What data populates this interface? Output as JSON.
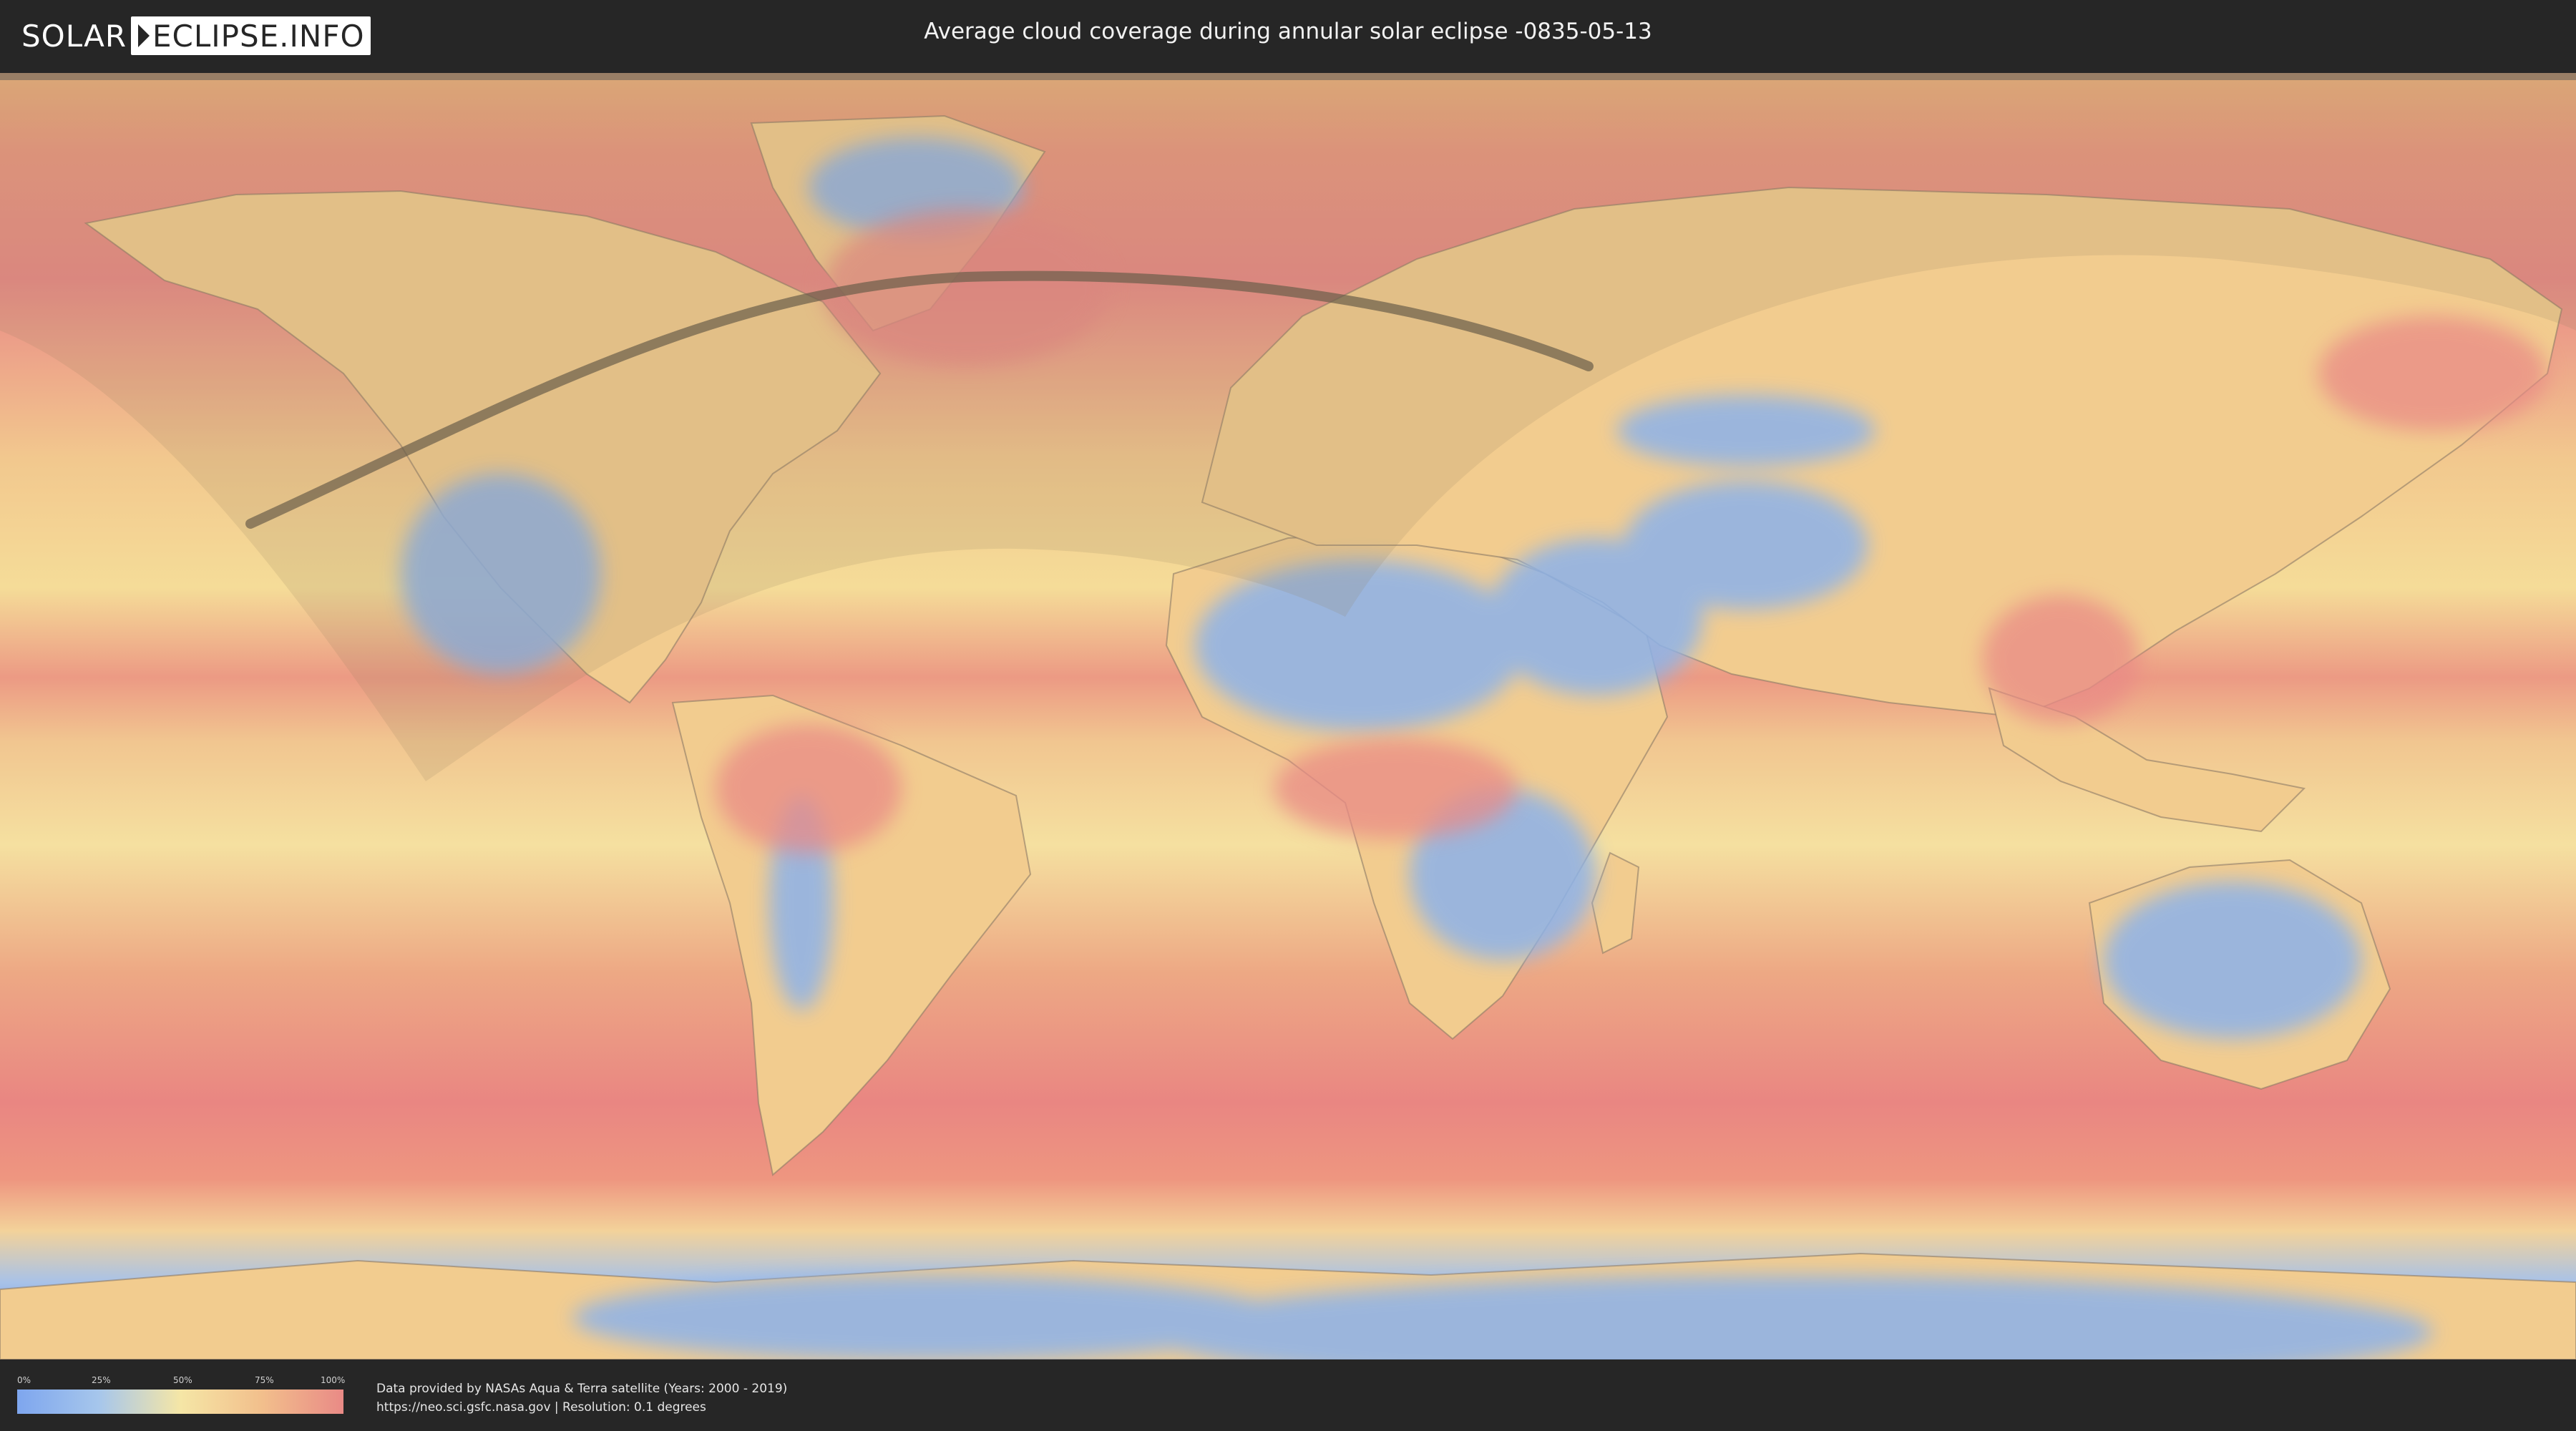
{
  "header": {
    "logo_left": "SOLAR",
    "logo_right": "ECLIPSE.INFO",
    "title": "Average cloud coverage during annular solar eclipse -0835-05-13"
  },
  "map": {
    "type": "cloud-coverage-world-map",
    "projection": "equirectangular",
    "overlays": [
      "eclipse-visibility-zone",
      "annularity-path"
    ]
  },
  "legend": {
    "ticks": [
      "0%",
      "25%",
      "50%",
      "75%",
      "100%"
    ],
    "colors": [
      "#7ea6ee",
      "#a6c6ec",
      "#f5e6a6",
      "#f2bf8c",
      "#e98a86"
    ]
  },
  "footer": {
    "credit_line1": "Data provided by NASAs Aqua & Terra satellite (Years: 2000 - 2019)",
    "credit_line2": "https://neo.sci.gsfc.nasa.gov | Resolution: 0.1 degrees"
  },
  "colors": {
    "background": "#262626",
    "ocean_cloudy": "#e98a86",
    "moderate": "#f5e0a0",
    "clear": "#8cb2ea",
    "path": "#6b5e4a"
  }
}
